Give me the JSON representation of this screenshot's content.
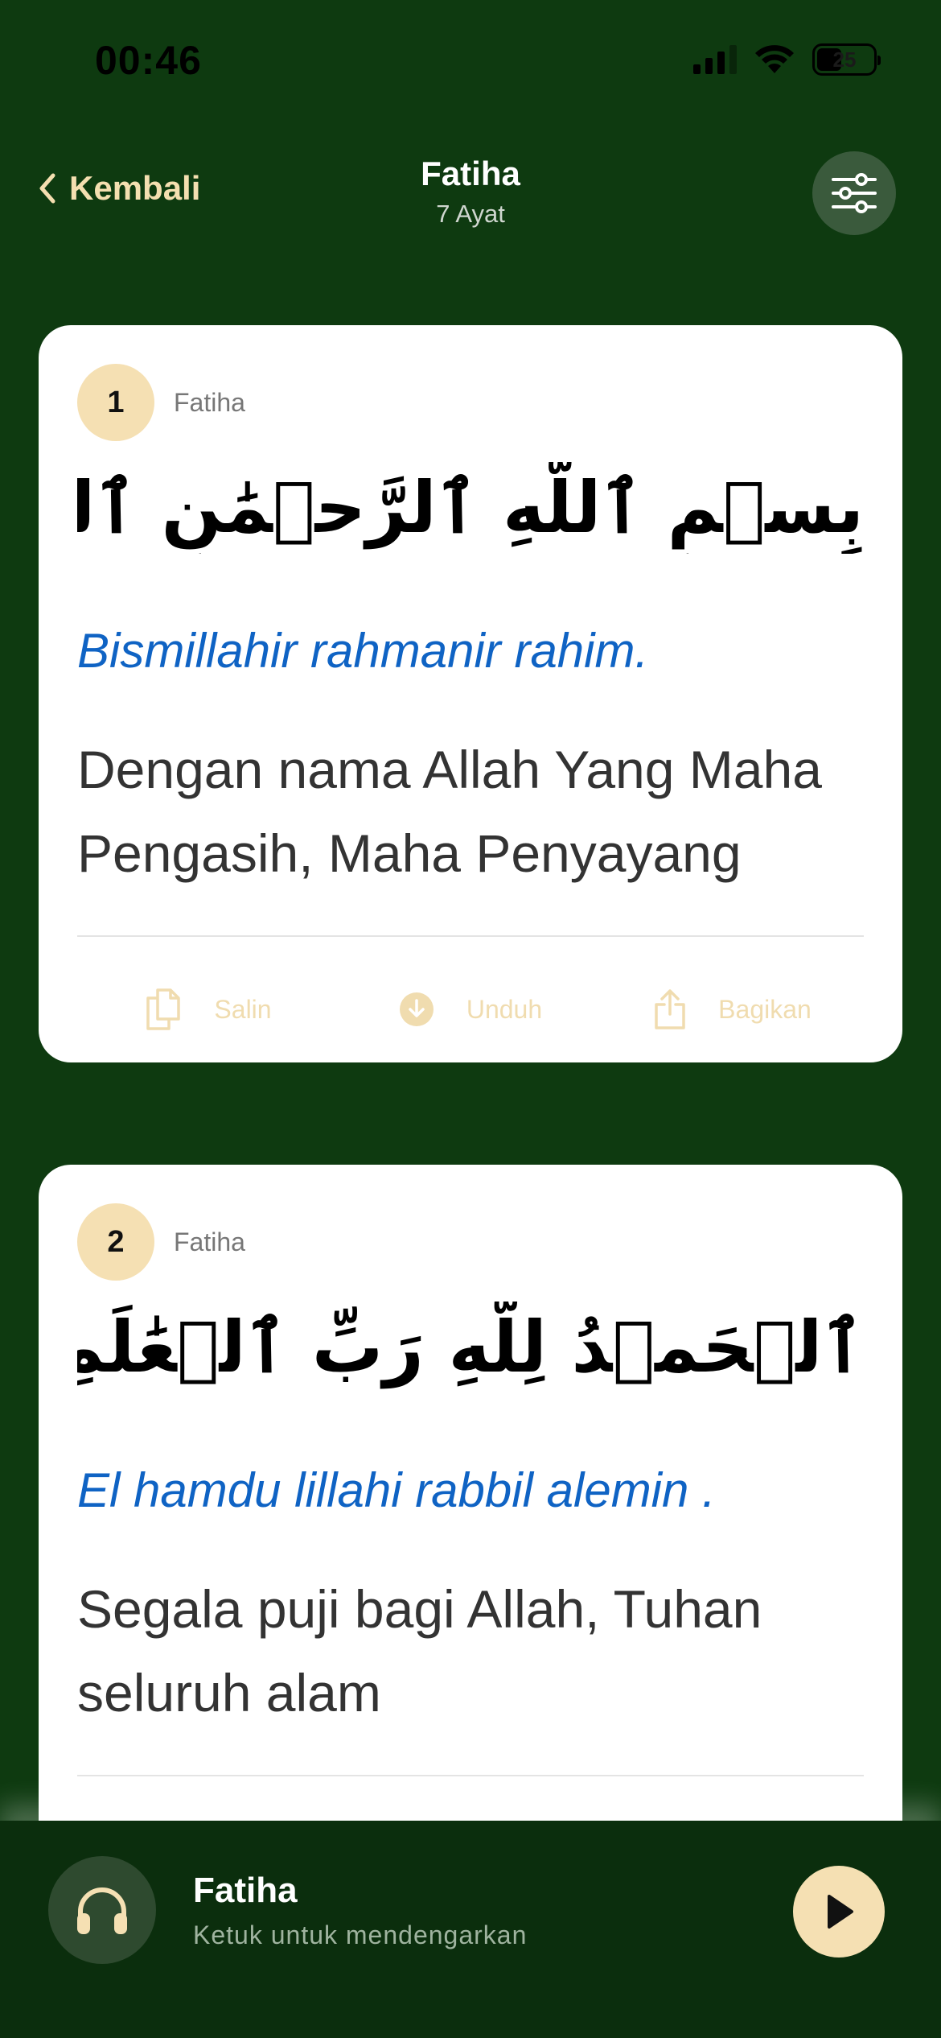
{
  "status": {
    "time": "00:46",
    "battery": "25"
  },
  "nav": {
    "back_label": "Kembali",
    "title": "Fatiha",
    "subtitle": "7 Ayat"
  },
  "ayahs": [
    {
      "number": "1",
      "surah": "Fatiha",
      "arabic": "بِسۡمِ ٱللَّهِ ٱلرَّحۡمَٰنِ ٱلرَّحِيمِ",
      "latin": "Bismillahir rahmanir rahim.",
      "translation": "Dengan nama Allah Yang Maha Pengasih, Maha Penyayang"
    },
    {
      "number": "2",
      "surah": "Fatiha",
      "arabic": "ٱلۡحَمۡدُ لِلَّهِ رَبِّ ٱلۡعَٰلَمِينَ",
      "latin": "El hamdu lillahi rabbil alemin .",
      "translation": "Segala puji bagi Allah, Tuhan seluruh alam"
    }
  ],
  "actions": {
    "copy": "Salin",
    "download": "Unduh",
    "share": "Bagikan"
  },
  "player": {
    "title": "Fatiha",
    "subtitle": "Ketuk untuk mendengarkan"
  },
  "colors": {
    "background": "#0e3a10",
    "accent": "#f5e0b3",
    "latin": "#0f63c4"
  }
}
